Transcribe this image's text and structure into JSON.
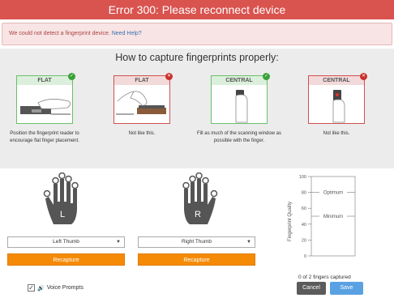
{
  "title": "Error 300: Please reconnect device",
  "alert": {
    "message": "We could not detect a fingerprint device.",
    "link": "Need Help?"
  },
  "guide": {
    "heading": "How to capture fingerprints properly:",
    "cards": [
      {
        "label": "FLAT",
        "status": "ok",
        "caption": "Position the fingerprint reader to encourage flat finger placement."
      },
      {
        "label": "FLAT",
        "status": "bad",
        "caption": "Not like this."
      },
      {
        "label": "CENTRAL",
        "status": "ok",
        "caption": "Fill as much of the scanning window as possible with the finger."
      },
      {
        "label": "CENTRAL",
        "status": "bad",
        "caption": "Not like this."
      }
    ]
  },
  "hands": {
    "left": {
      "letter": "L",
      "selected": "Left Thumb",
      "recapture": "Recapture"
    },
    "right": {
      "letter": "R",
      "selected": "Right Thumb",
      "recapture": "Recapture"
    }
  },
  "quality": {
    "axis_label": "Fingerprint Quality",
    "ticks": [
      "100",
      "80",
      "60",
      "40",
      "20",
      "0"
    ],
    "optimum": "Optimum",
    "minimum": "Minimum",
    "optimum_value": 80,
    "minimum_value": 50
  },
  "footer": {
    "status": "0 of 2 fingers captured",
    "cancel": "Cancel",
    "save": "Save",
    "voice_prompts": "Voice Prompts",
    "voice_checked": true
  },
  "colors": {
    "error": "#d9534f",
    "recapture": "#f58a07",
    "save": "#5aa1e3",
    "ok": "#3aa03a",
    "bad": "#c9302c"
  }
}
